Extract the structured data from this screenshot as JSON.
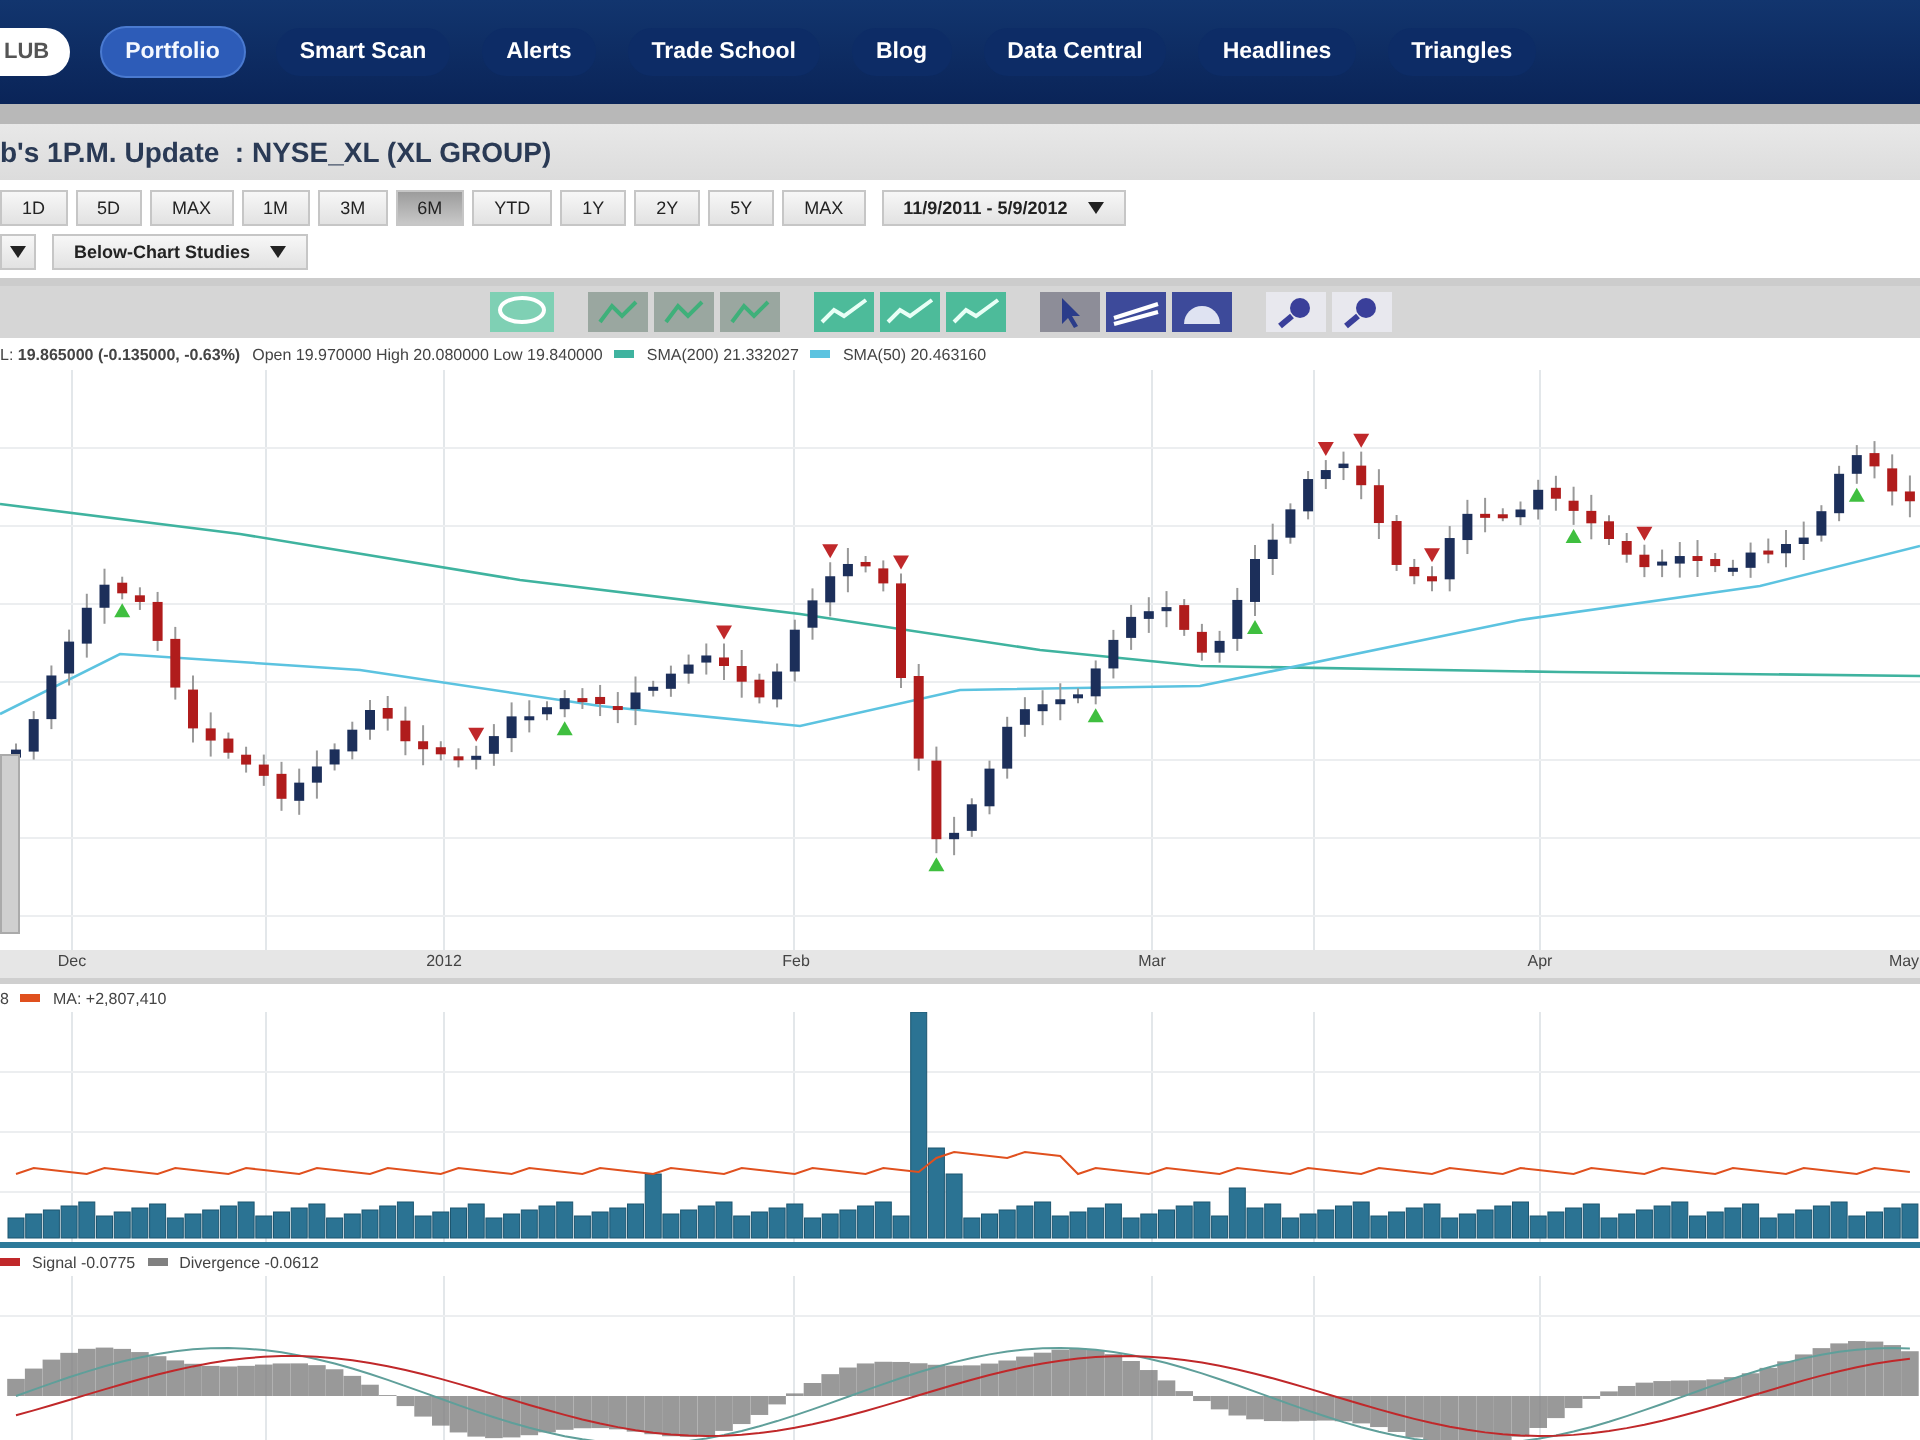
{
  "nav": {
    "items": [
      {
        "label": "LUB",
        "kind": "logo"
      },
      {
        "label": "Portfolio",
        "kind": "tab",
        "selected": true
      },
      {
        "label": "Smart Scan",
        "kind": "tab",
        "selected": false
      },
      {
        "label": "Alerts",
        "kind": "tab",
        "selected": false
      },
      {
        "label": "Trade School",
        "kind": "tab",
        "selected": false
      },
      {
        "label": "Blog",
        "kind": "tab",
        "selected": false
      },
      {
        "label": "Data Central",
        "kind": "tab",
        "selected": false
      },
      {
        "label": "Headlines",
        "kind": "tab",
        "selected": false
      },
      {
        "label": "Triangles",
        "kind": "tab",
        "selected": false
      }
    ]
  },
  "title": "b's 1P.M. Update  : NYSE_XL (XL GROUP)",
  "range_buttons": [
    {
      "label": "1D",
      "selected": false
    },
    {
      "label": "5D",
      "selected": false
    },
    {
      "label": "MAX",
      "selected": false
    },
    {
      "label": "1M",
      "selected": false
    },
    {
      "label": "3M",
      "selected": false
    },
    {
      "label": "6M",
      "selected": true
    },
    {
      "label": "YTD",
      "selected": false
    },
    {
      "label": "1Y",
      "selected": false
    },
    {
      "label": "2Y",
      "selected": false
    },
    {
      "label": "5Y",
      "selected": false
    },
    {
      "label": "MAX",
      "selected": false
    }
  ],
  "date_range": {
    "value": "11/9/2011 - 5/9/2012"
  },
  "studies_dropdown": {
    "value": "Below-Chart Studies"
  },
  "price_legend": {
    "quote": "L: **19.865000 (-0.135000, -0.63%)**",
    "ohlc": "Open 19.970000 High 20.080000 Low 19.840000",
    "series": [
      {
        "label": "SMA(200) 21.332027",
        "color": "#3fb39f"
      },
      {
        "label": "SMA(50) 20.463160",
        "color": "#5cc3e0"
      }
    ]
  },
  "x_labels": [
    "Dec",
    "2012",
    "Feb",
    "Mar",
    "Apr",
    "May"
  ],
  "volume_legend": {
    "fragment": "8",
    "series": [
      {
        "label": "MA: +2,807,410",
        "color": "#e0501e"
      }
    ]
  },
  "macd_legend": {
    "series": [
      {
        "label": "Signal -0.0775",
        "color": "#c0282a"
      },
      {
        "label": "Divergence -0.0612",
        "color": "#808080"
      }
    ]
  }
}
